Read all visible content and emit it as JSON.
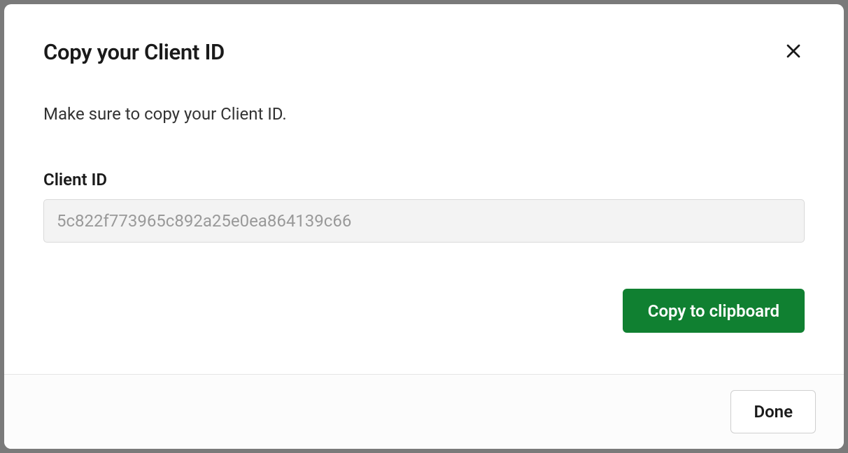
{
  "modal": {
    "title": "Copy your Client ID",
    "instruction": "Make sure to copy your Client ID.",
    "field_label": "Client ID",
    "client_id_value": "5c822f773965c892a25e0ea864139c66",
    "copy_button_label": "Copy to clipboard",
    "done_button_label": "Done"
  }
}
